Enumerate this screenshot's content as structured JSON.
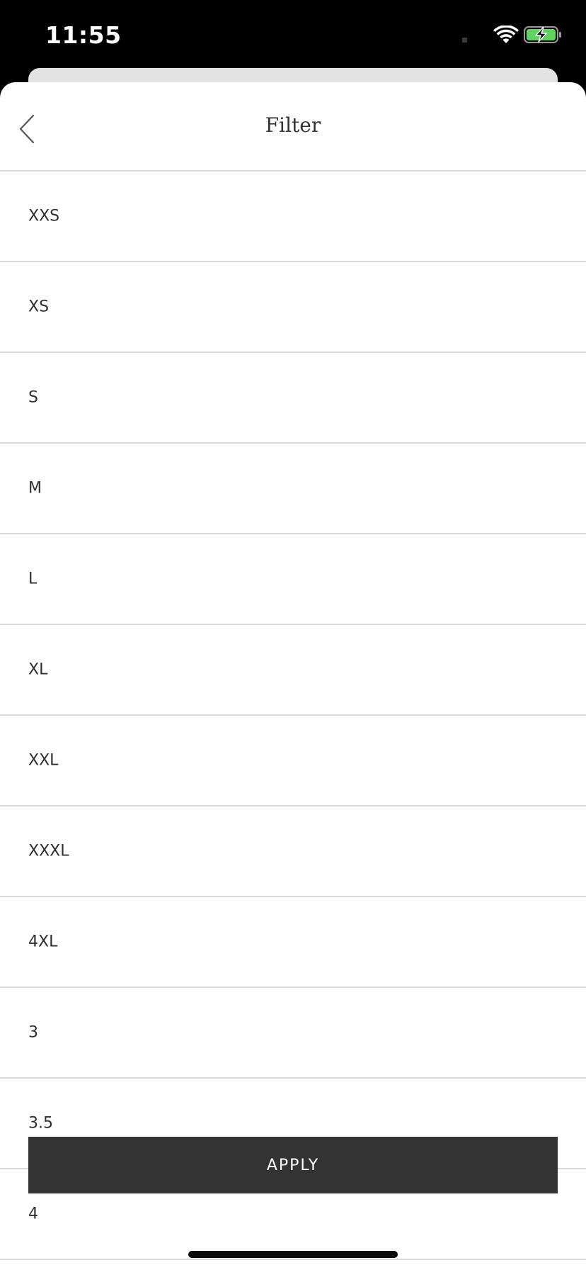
{
  "status_bar": {
    "time": "11:55",
    "wifi_icon": "wifi-icon",
    "battery_icon": "battery-charging-icon",
    "battery_color": "#5fd35f"
  },
  "header": {
    "title": "Filter",
    "back_icon": "chevron-left-icon"
  },
  "size_options": [
    {
      "label": "XXS"
    },
    {
      "label": "XS"
    },
    {
      "label": "S"
    },
    {
      "label": "M"
    },
    {
      "label": "L"
    },
    {
      "label": "XL"
    },
    {
      "label": "XXL"
    },
    {
      "label": "XXXL"
    },
    {
      "label": "4XL"
    },
    {
      "label": "3"
    },
    {
      "label": "3.5"
    },
    {
      "label": "4"
    }
  ],
  "footer": {
    "apply_label": "APPLY"
  },
  "colors": {
    "apply_button_bg": "#333333",
    "divider": "#d9d9d9"
  }
}
